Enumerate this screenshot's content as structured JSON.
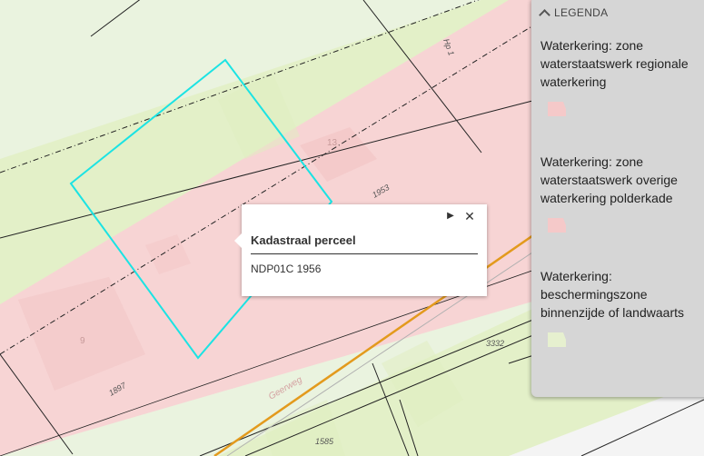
{
  "map": {
    "parcel_labels": [
      "1953",
      "13",
      "1897",
      "9",
      "3332",
      "1585"
    ],
    "street_name": "Geerweg",
    "road_label": "Hp 1"
  },
  "popup": {
    "title": "Kadastraal perceel",
    "value": "NDP01C 1956",
    "next_icon": "▶",
    "close_icon": "✕"
  },
  "legend": {
    "title": "LEGENDA",
    "items": [
      {
        "label": "Waterkering: zone waterstaatswerk regionale waterkering",
        "color": "#f5c9c9"
      },
      {
        "label": "Waterkering: zone waterstaatswerk overige waterkering polderkade",
        "color": "#f5c9c9"
      },
      {
        "label": "Waterkering: beschermingszone binnenzijde of landwaarts",
        "color": "#e6f0cf"
      }
    ]
  },
  "colors": {
    "water_zone": "#f7d4d4",
    "protection_zone": "#e5f2cc",
    "selection": "#1be3e3",
    "road_line": "#e39a1d"
  }
}
